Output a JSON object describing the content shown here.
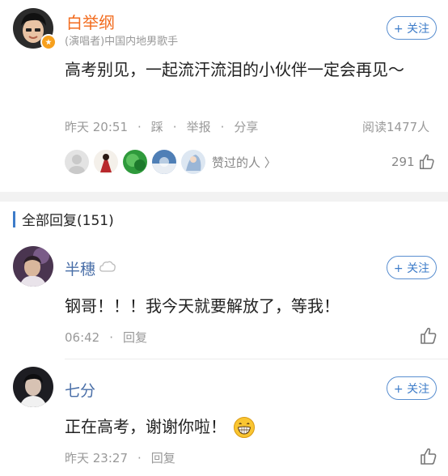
{
  "post": {
    "author": "白举纲",
    "verify_text": "(演唱者)中国内地男歌手",
    "follow_label": "+ 关注",
    "content": "高考别见，一起流汗流泪的小伙伴一定会再见～",
    "time": "昨天 20:51",
    "action_step": "踩",
    "action_report": "举报",
    "action_share": "分享",
    "read_count": "阅读1477人",
    "likers_label": "赞过的人 〉",
    "like_count": "291"
  },
  "replies": {
    "title": "全部回复(151)",
    "items": [
      {
        "author": "半穗",
        "follow_label": "+ 关注",
        "content": "钢哥！！！我今天就要解放了，等我！",
        "time": "06:42",
        "reply_label": "回复"
      },
      {
        "author": "七分",
        "follow_label": "+ 关注",
        "content": "正在高考，谢谢你啦！",
        "time": "昨天 23:27",
        "reply_label": "回复"
      }
    ]
  },
  "colors": {
    "accent": "#3d7cc9",
    "author_orange": "#f26b1d",
    "name_blue": "#4a6fa8",
    "muted": "#999999"
  }
}
